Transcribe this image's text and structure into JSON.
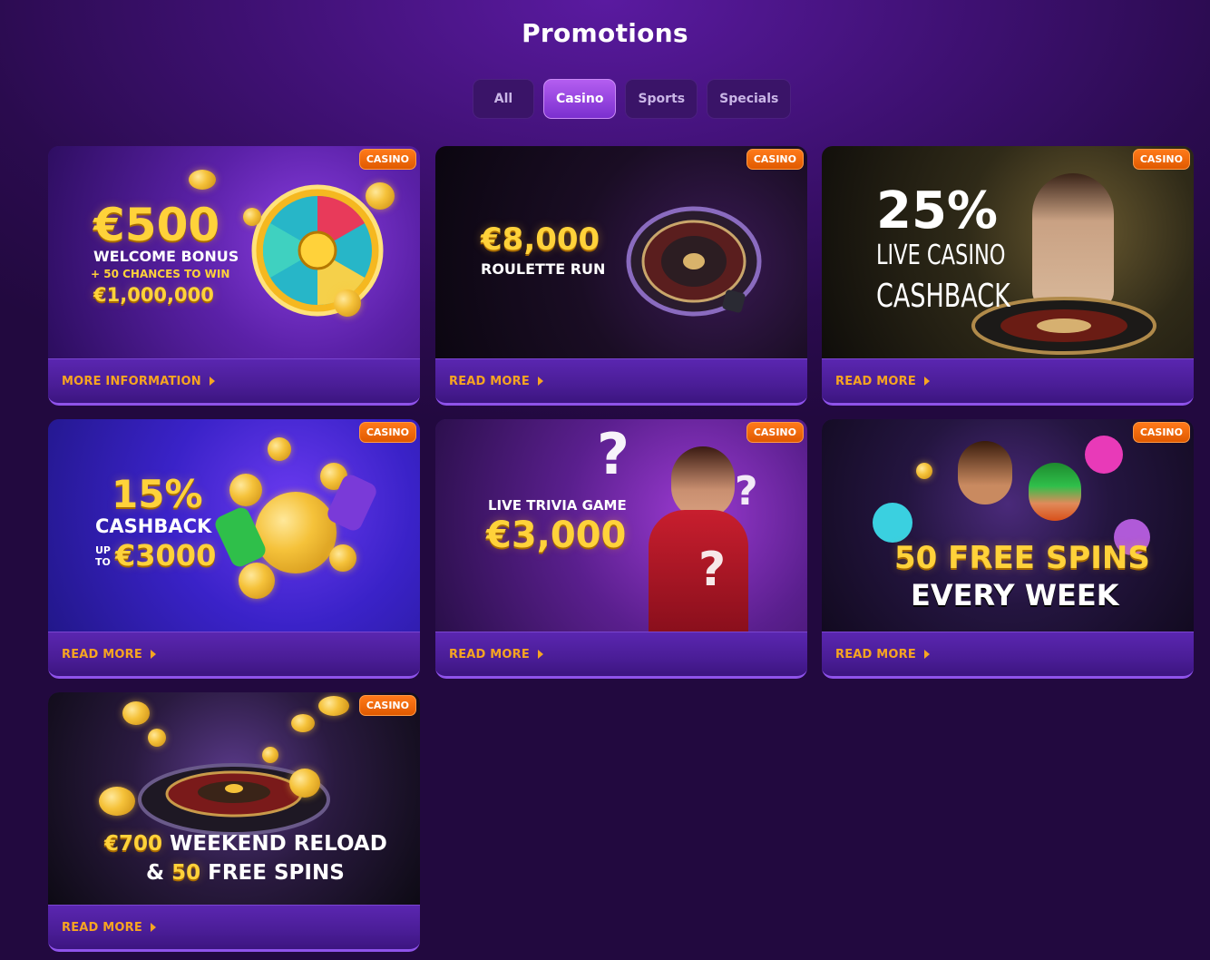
{
  "page": {
    "title": "Promotions"
  },
  "tabs": [
    {
      "label": "All",
      "active": false
    },
    {
      "label": "Casino",
      "active": true
    },
    {
      "label": "Sports",
      "active": false
    },
    {
      "label": "Specials",
      "active": false
    }
  ],
  "cards": [
    {
      "badge": "CASINO",
      "cta": "MORE INFORMATION",
      "art": {
        "amount": "€500",
        "line1": "WELCOME BONUS",
        "line2": "+ 50 CHANCES TO WIN",
        "line3": "€1,000,000"
      }
    },
    {
      "badge": "CASINO",
      "cta": "READ MORE",
      "art": {
        "amount": "€8,000",
        "line1": "ROULETTE RUN"
      }
    },
    {
      "badge": "CASINO",
      "cta": "READ MORE",
      "art": {
        "amount": "25%",
        "line1": "LIVE CASINO",
        "line2": "CASHBACK"
      }
    },
    {
      "badge": "CASINO",
      "cta": "READ MORE",
      "art": {
        "amount": "15%",
        "line1": "CASHBACK",
        "line2": "UP TO",
        "line3": "€3000"
      }
    },
    {
      "badge": "CASINO",
      "cta": "READ MORE",
      "art": {
        "line1": "LIVE TRIVIA GAME",
        "amount": "€3,000"
      }
    },
    {
      "badge": "CASINO",
      "cta": "READ MORE",
      "art": {
        "line1": "50 FREE SPINS",
        "line2": "EVERY WEEK"
      }
    },
    {
      "badge": "CASINO",
      "cta": "READ MORE",
      "art": {
        "amount": "€700",
        "line1": "WEEKEND RELOAD",
        "line2": "&",
        "line3": "50",
        "line4": "FREE SPINS"
      }
    }
  ],
  "colors": {
    "accent": "#f7a521",
    "badge": "#ff6a00",
    "tab_active": "#9a45e0",
    "gold": "#ffd23a"
  }
}
